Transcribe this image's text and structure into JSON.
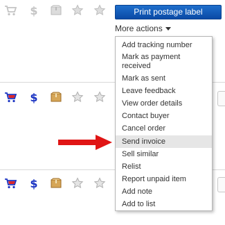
{
  "rows": [
    {
      "active": false
    },
    {
      "active": true
    },
    {
      "active": true
    }
  ],
  "colors": {
    "cart": "#1a33c2",
    "dollar": "#1a33c2",
    "inactive": "#c2c2c2",
    "button": "#0f5fbf",
    "arrow": "#e01515",
    "highlight": "#e6e6e6"
  },
  "icons": [
    "cart-icon",
    "dollar-icon",
    "package-icon",
    "star-icon",
    "star-icon"
  ],
  "toolbar": {
    "print_label": "Print postage label",
    "more_actions": "More actions"
  },
  "menu": {
    "items": [
      "Add tracking number",
      "Mark as payment received",
      "Mark as sent",
      "Leave feedback",
      "View order details",
      "Contact buyer",
      "Cancel order",
      "Send invoice",
      "Sell similar",
      "Relist",
      "Report unpaid item",
      "Add note",
      "Add to list"
    ],
    "highlighted": "Send invoice"
  }
}
